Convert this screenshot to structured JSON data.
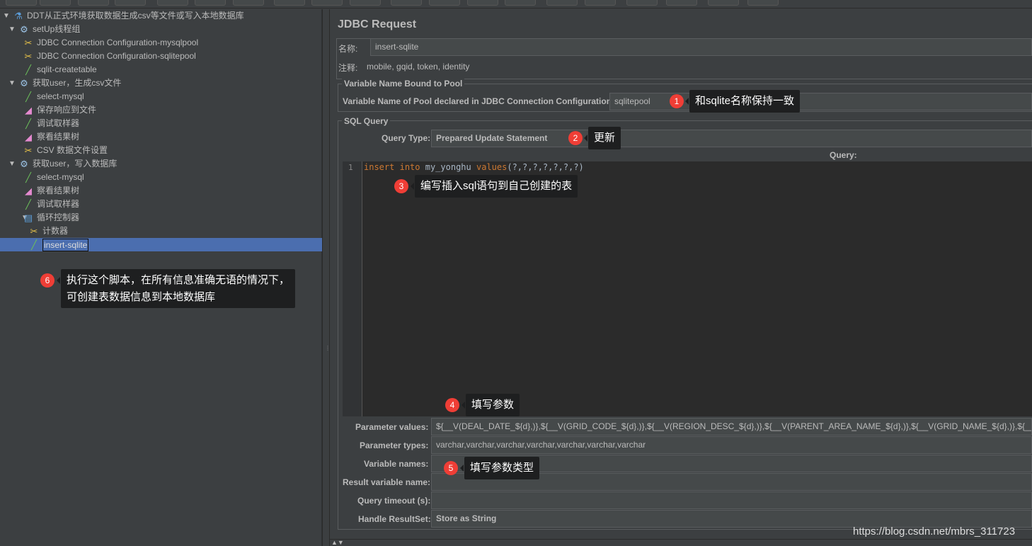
{
  "tree": [
    {
      "label": "DDT从正式环境获取数据生成csv等文件或写入本地数据库",
      "icon": "test-plan-flask-icon",
      "depth": 0,
      "expanded": true
    },
    {
      "label": "setUp线程组",
      "icon": "thread-group-gear-icon",
      "depth": 1,
      "expanded": true
    },
    {
      "label": "JDBC Connection Configuration-mysqlpool",
      "icon": "config-wrench-icon",
      "depth": 2
    },
    {
      "label": "JDBC Connection Configuration-sqlitepool",
      "icon": "config-wrench-icon",
      "depth": 2
    },
    {
      "label": "sqlit-createtable",
      "icon": "sampler-pipette-icon",
      "depth": 2
    },
    {
      "label": "获取user，生成csv文件",
      "icon": "thread-group-gear-icon",
      "depth": 1,
      "expanded": true
    },
    {
      "label": "select-mysql",
      "icon": "sampler-pipette-icon",
      "depth": 2
    },
    {
      "label": "保存响应到文件",
      "icon": "listener-chart-icon",
      "depth": 2
    },
    {
      "label": "调试取样器",
      "icon": "sampler-pipette-icon",
      "depth": 2
    },
    {
      "label": "察看结果树",
      "icon": "listener-chart-icon",
      "depth": 2
    },
    {
      "label": "CSV 数据文件设置",
      "icon": "config-wrench-icon",
      "depth": 2
    },
    {
      "label": "获取user，写入数据库",
      "icon": "thread-group-gear-icon",
      "depth": 1,
      "expanded": true
    },
    {
      "label": "select-mysql",
      "icon": "sampler-pipette-icon",
      "depth": 2
    },
    {
      "label": "察看结果树",
      "icon": "listener-chart-icon",
      "depth": 2
    },
    {
      "label": "调试取样器",
      "icon": "sampler-pipette-icon",
      "depth": 2
    },
    {
      "label": "循环控制器",
      "icon": "loop-controller-icon",
      "depth": 2,
      "expanded": true
    },
    {
      "label": "计数器",
      "icon": "config-wrench-icon",
      "depth": 3
    },
    {
      "label": "insert-sqlite",
      "icon": "sampler-pipette-icon",
      "depth": 3,
      "selected": true
    }
  ],
  "main": {
    "title": "JDBC Request",
    "name_label": "名称:",
    "name_value": "insert-sqlite",
    "comment_label": "注释:",
    "comment_value": "mobile, gqid, token, identity",
    "pool_group": "Variable Name Bound to Pool",
    "pool_label": "Variable Name of Pool declared in JDBC Connection Configuration:",
    "pool_value": "sqlitepool",
    "sql_group": "SQL Query",
    "query_type_label": "Query Type:",
    "query_type_value": "Prepared Update Statement",
    "query_label": "Query:",
    "line_number": "1",
    "code": {
      "kw1": "insert",
      "kw2": "into",
      "table": "my_yonghu",
      "kw3": "values",
      "args": "(?,?,?,?,?,?,?)"
    },
    "param_values_label": "Parameter values:",
    "param_values": "${__V(DEAL_DATE_${d},)},${__V(GRID_CODE_${d},)},${__V(REGION_DESC_${d},)},${__V(PARENT_AREA_NAME_${d},)},${__V(GRID_NAME_${d},)},${__",
    "param_types_label": "Parameter types:",
    "param_types": "varchar,varchar,varchar,varchar,varchar,varchar,varchar",
    "var_names_label": "Variable names:",
    "var_names": "",
    "result_var_label": "Result variable name:",
    "result_var": "",
    "timeout_label": "Query timeout (s):",
    "timeout": "",
    "handle_label": "Handle ResultSet:",
    "handle_value": "Store as String"
  },
  "annotations": [
    {
      "n": "1",
      "text": "和sqlite名称保持一致"
    },
    {
      "n": "2",
      "text": "更新"
    },
    {
      "n": "3",
      "text": "编写插入sql语句到自己创建的表"
    },
    {
      "n": "4",
      "text": "填写参数"
    },
    {
      "n": "5",
      "text": "填写参数类型"
    },
    {
      "n": "6",
      "text": "执行这个脚本，在所有信息准确无语的情况下，",
      "text2": "可创建表数据信息到本地数据库"
    }
  ],
  "watermark": "https://blog.csdn.net/mbrs_311723",
  "colors": {
    "selection": "#4b6eaf",
    "badge": "#ef3e36",
    "keyword": "#cc7832",
    "background": "#3c3f41"
  }
}
